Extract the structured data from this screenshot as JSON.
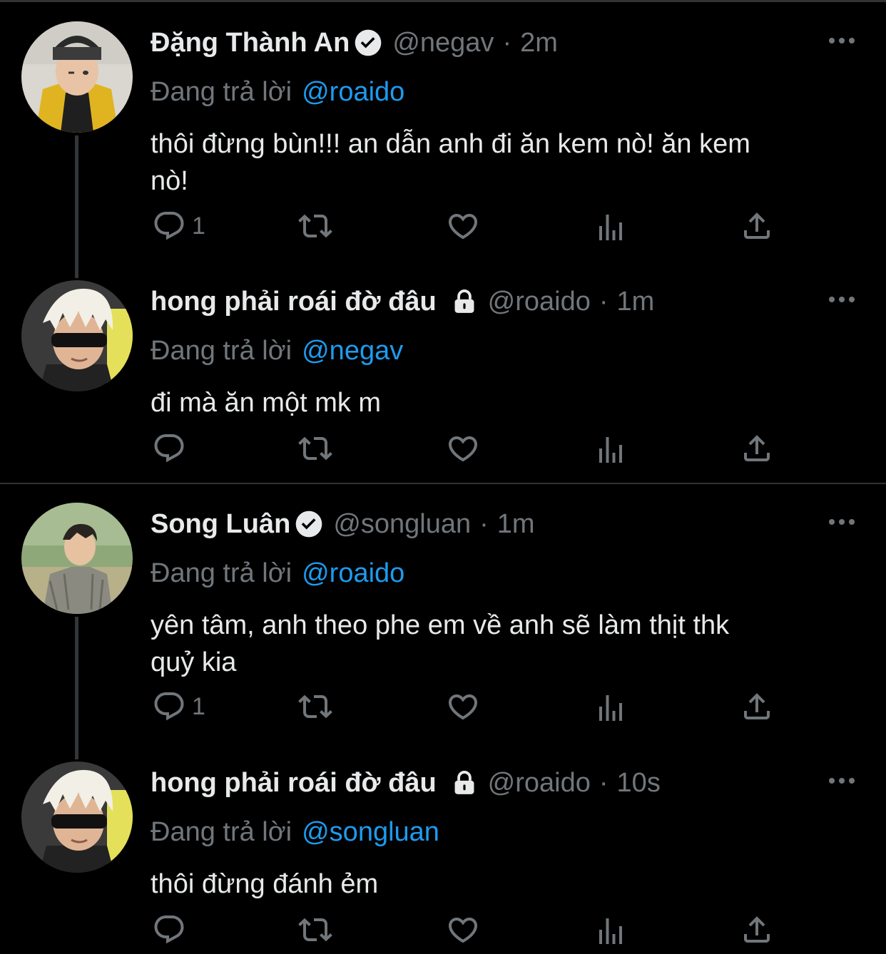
{
  "tweets": [
    {
      "display_name": "Đặng Thành An",
      "verified": true,
      "locked": false,
      "handle": "@negav",
      "separator": "·",
      "time": "2m",
      "reply_prefix": "Đang trả lời",
      "reply_to": "@roaido",
      "body_lines": [
        "thôi đừng bùn!!! an dẫn anh đi ăn kem nò! ăn kem",
        "nò!"
      ],
      "reply_count": "1",
      "avatar_icon": "avatar-negav"
    },
    {
      "display_name": "hong phải roái đờ đâu",
      "verified": false,
      "locked": true,
      "handle": "@roaido",
      "separator": "·",
      "time": "1m",
      "reply_prefix": "Đang trả lời",
      "reply_to": "@negav",
      "body_lines": [
        "đi mà ăn một mk m"
      ],
      "reply_count": "",
      "avatar_icon": "avatar-roaido"
    },
    {
      "display_name": "Song Luân",
      "verified": true,
      "locked": false,
      "handle": "@songluan",
      "separator": "·",
      "time": "1m",
      "reply_prefix": "Đang trả lời",
      "reply_to": "@roaido",
      "body_lines": [
        "yên tâm, anh theo phe em về anh sẽ làm thịt thk",
        "quỷ kia"
      ],
      "reply_count": "1",
      "avatar_icon": "avatar-songluan"
    },
    {
      "display_name": "hong phải roái đờ đâu",
      "verified": false,
      "locked": true,
      "handle": "@roaido",
      "separator": "·",
      "time": "10s",
      "reply_prefix": "Đang trả lời",
      "reply_to": "@songluan",
      "body_lines": [
        "thôi đừng đánh ẻm"
      ],
      "reply_count": "",
      "avatar_icon": "avatar-roaido"
    }
  ],
  "icons": {
    "reply": "reply-icon",
    "retweet": "retweet-icon",
    "like": "like-icon",
    "views": "views-icon",
    "share": "share-icon",
    "more": "more-icon",
    "verified": "verified-badge-icon",
    "protected": "lock-icon"
  },
  "colors": {
    "background": "#000000",
    "text": "#e7e9ea",
    "muted": "#71767b",
    "link": "#1d9bf0",
    "divider": "#2f3336"
  }
}
